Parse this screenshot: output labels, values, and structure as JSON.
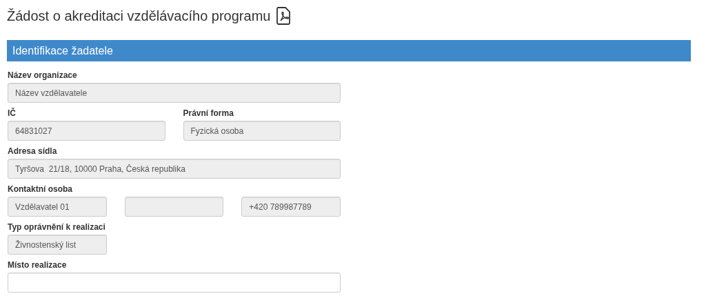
{
  "title": "Žádost o akreditaci vzdělávacího programu",
  "section": {
    "heading": "Identifikace žadatele"
  },
  "rows": [
    {
      "kind": "full",
      "cells": [
        {
          "label": "Název organizace",
          "inputs": [
            {
              "value": "Název vzdělavatele",
              "disabled": true
            }
          ]
        }
      ]
    },
    {
      "kind": "half",
      "cells": [
        {
          "label": "IČ",
          "inputs": [
            {
              "value": "64831027",
              "disabled": true
            }
          ]
        },
        {
          "label": "Právní forma",
          "inputs": [
            {
              "value": "Fyzická osoba",
              "disabled": true
            }
          ]
        }
      ]
    },
    {
      "kind": "full",
      "cells": [
        {
          "label": "Adresa sídla",
          "inputs": [
            {
              "value": "Tyršova  21/18, 10000 Praha, Česká republika",
              "disabled": true
            }
          ]
        }
      ]
    },
    {
      "kind": "third",
      "cells": [
        {
          "label": "Kontaktní osoba",
          "inputs": [
            {
              "value": "Vzdělavatel 01",
              "disabled": true
            },
            {
              "disabled": true
            },
            {
              "value": "+420 789987789",
              "disabled": true
            }
          ]
        }
      ]
    },
    {
      "kind": "third",
      "cells": [
        {
          "label": "Typ oprávnění k realizaci",
          "inputs": [
            {
              "value": "Živnostenský list",
              "disabled": true
            }
          ]
        }
      ]
    },
    {
      "kind": "full",
      "cells": [
        {
          "label": "Místo realizace",
          "inputs": [
            {
              "disabled": false
            }
          ]
        }
      ]
    }
  ]
}
